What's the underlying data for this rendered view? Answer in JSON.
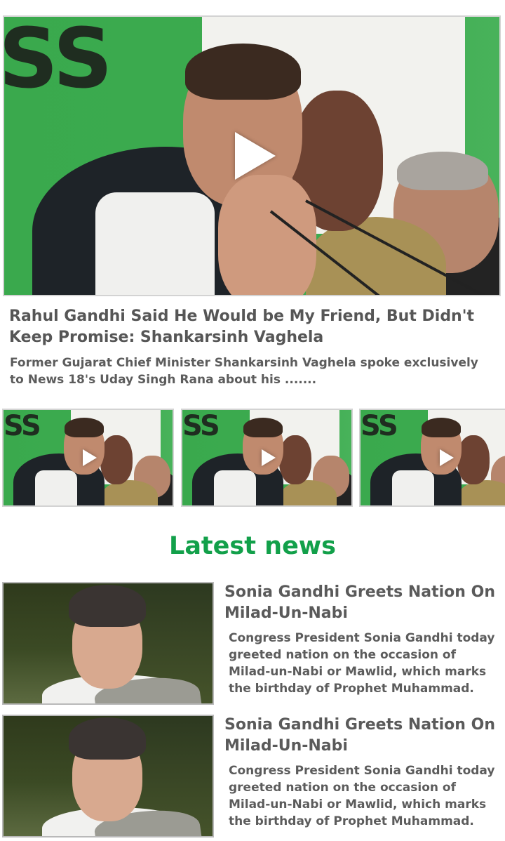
{
  "featured": {
    "title": "Rahul Gandhi Said He Would be My Friend, But Didn't Keep Promise: Shankarsinh Vaghela",
    "description": "Former Gujarat Chief Minister Shankarsinh Vaghela spoke exclusively to News 18's Uday Singh Rana about his .......",
    "backdrop_text": "SS",
    "play_icon": "play-icon"
  },
  "thumbnails": [
    {
      "backdrop_text": "SS",
      "play_icon": "play-icon"
    },
    {
      "backdrop_text": "SS",
      "play_icon": "play-icon"
    },
    {
      "backdrop_text": "SS",
      "play_icon": "play-icon"
    }
  ],
  "latest_news": {
    "heading": "Latest news",
    "heading_color": "#12a04a",
    "items": [
      {
        "title": "Sonia Gandhi Greets Nation On Milad-Un-Nabi",
        "description": "Congress President Sonia Gandhi today greeted nation on the occasion of Milad-un-Nabi or Mawlid, which marks the birthday of Prophet Muhammad."
      },
      {
        "title": "Sonia Gandhi Greets Nation On Milad-Un-Nabi",
        "description": "Congress President Sonia Gandhi today greeted nation on the occasion of Milad-un-Nabi or Mawlid, which marks the birthday of Prophet Muhammad."
      }
    ]
  }
}
